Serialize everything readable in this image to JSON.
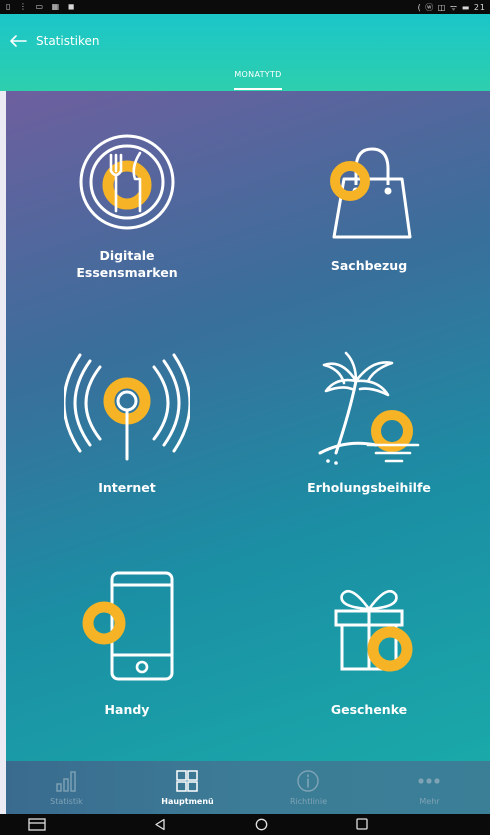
{
  "status_bar": {
    "left_icons": "▯ ⋮ ▭ ▦ ◼",
    "right_text": "( ⓦ ◫ ᯤ ▬ 21"
  },
  "header": {
    "title": "Statistiken",
    "back_icon": "arrow-left-icon"
  },
  "tabs": [
    {
      "label": "MONATYTD",
      "selected": true
    }
  ],
  "tiles": [
    {
      "label_line1": "Digitale",
      "label_line2": "Essensmarken",
      "icon": "plate-cutlery-icon"
    },
    {
      "label_line1": "Sachbezug",
      "label_line2": "",
      "icon": "shopping-bag-icon"
    },
    {
      "label_line1": "Internet",
      "label_line2": "",
      "icon": "wifi-signal-icon"
    },
    {
      "label_line1": "Erholungsbeihilfe",
      "label_line2": "",
      "icon": "palm-beach-icon"
    },
    {
      "label_line1": "Handy",
      "label_line2": "",
      "icon": "smartphone-icon"
    },
    {
      "label_line1": "Geschenke",
      "label_line2": "",
      "icon": "gift-icon"
    }
  ],
  "bottom_nav": [
    {
      "label": "Statistik",
      "icon": "bar-chart-icon",
      "active": false
    },
    {
      "label": "Hauptmenü",
      "icon": "grid-icon",
      "active": true
    },
    {
      "label": "Richtlinie",
      "icon": "info-icon",
      "active": false
    },
    {
      "label": "Mehr",
      "icon": "more-dots-icon",
      "active": false
    }
  ],
  "colors": {
    "accent_ring": "#f5b325",
    "header_start": "#1bc6c9",
    "header_end": "#2dcfad",
    "icon_stroke": "#ffffff"
  }
}
